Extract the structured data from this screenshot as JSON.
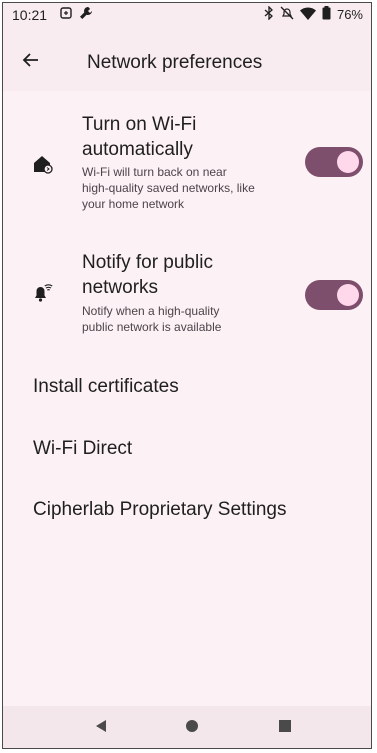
{
  "status_bar": {
    "time": "10:21",
    "battery": "76%",
    "icons": [
      "sync-icon",
      "wrench-icon",
      "bluetooth-icon",
      "mute-icon",
      "wifi-icon",
      "battery-icon"
    ]
  },
  "app_bar": {
    "title": "Network preferences",
    "back_icon": "arrow-left-icon"
  },
  "settings": {
    "wifi_auto": {
      "title_line1": "Turn on Wi-Fi",
      "title_line2": "automatically",
      "subtitle_line1": "Wi-Fi will turn back on near",
      "subtitle_line2": "high-quality saved networks, like",
      "subtitle_line3": "your home network",
      "enabled": true,
      "icon": "home-wifi-icon"
    },
    "notify_public": {
      "title_line1": "Notify for public",
      "title_line2": "networks",
      "subtitle_line1": "Notify when a high-quality",
      "subtitle_line2": "public network is available",
      "enabled": true,
      "icon": "wifi-notification-icon"
    },
    "items": [
      {
        "label": "Install certificates"
      },
      {
        "label": "Wi-Fi Direct"
      },
      {
        "label": "Cipherlab Proprietary Settings"
      }
    ]
  },
  "colors": {
    "background": "#fcf1f5",
    "switch_track": "#7e4f6d",
    "switch_knob": "#ffd8ec"
  }
}
